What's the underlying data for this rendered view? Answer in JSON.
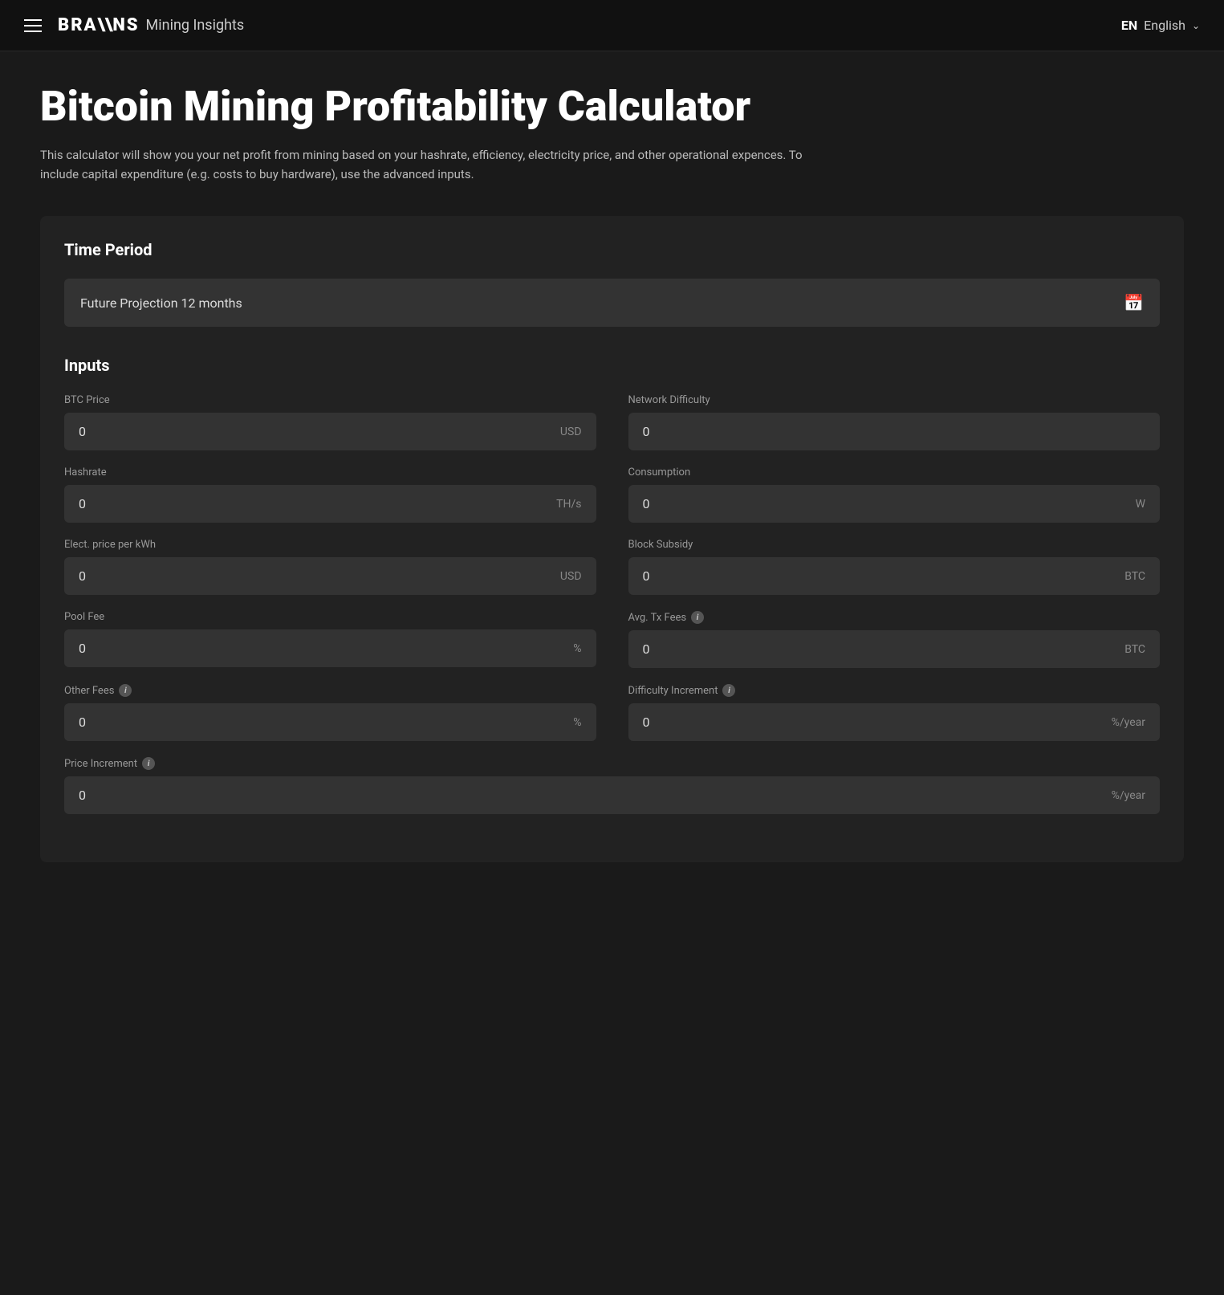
{
  "navbar": {
    "menu_icon_label": "Menu",
    "brand_logo": "BRA\\\\NS",
    "brand_name": "Mining Insights",
    "lang_code": "EN",
    "lang_label": "English",
    "lang_chevron": "∨"
  },
  "hero": {
    "title": "Bitcoin Mining Profitability Calculator",
    "description": "This calculator will show you your net profit from mining based on your hashrate, efficiency, electricity price, and other operational expences. To include capital expenditure (e.g. costs to buy hardware), use the advanced inputs."
  },
  "time_period": {
    "section_title": "Time Period",
    "value": "Future Projection 12 months",
    "calendar_icon": "📅"
  },
  "inputs": {
    "section_title": "Inputs",
    "fields": [
      {
        "label": "BTC Price",
        "value": "0",
        "unit": "USD",
        "has_info": false,
        "full_width": false
      },
      {
        "label": "Network Difficulty",
        "value": "0",
        "unit": "",
        "has_info": false,
        "full_width": false
      },
      {
        "label": "Hashrate",
        "value": "0",
        "unit": "TH/s",
        "has_info": false,
        "full_width": false
      },
      {
        "label": "Consumption",
        "value": "0",
        "unit": "W",
        "has_info": false,
        "full_width": false
      },
      {
        "label": "Elect. price per kWh",
        "value": "0",
        "unit": "USD",
        "has_info": false,
        "full_width": false
      },
      {
        "label": "Block Subsidy",
        "value": "0",
        "unit": "BTC",
        "has_info": false,
        "full_width": false
      },
      {
        "label": "Pool Fee",
        "value": "0",
        "unit": "%",
        "has_info": false,
        "full_width": false
      },
      {
        "label": "Avg. Tx Fees",
        "value": "0",
        "unit": "BTC",
        "has_info": true,
        "full_width": false
      },
      {
        "label": "Other Fees",
        "value": "0",
        "unit": "%",
        "has_info": true,
        "full_width": false
      },
      {
        "label": "Difficulty Increment",
        "value": "0",
        "unit": "%/year",
        "has_info": true,
        "full_width": false
      },
      {
        "label": "Price Increment",
        "value": "0",
        "unit": "%/year",
        "has_info": true,
        "full_width": true
      }
    ]
  }
}
